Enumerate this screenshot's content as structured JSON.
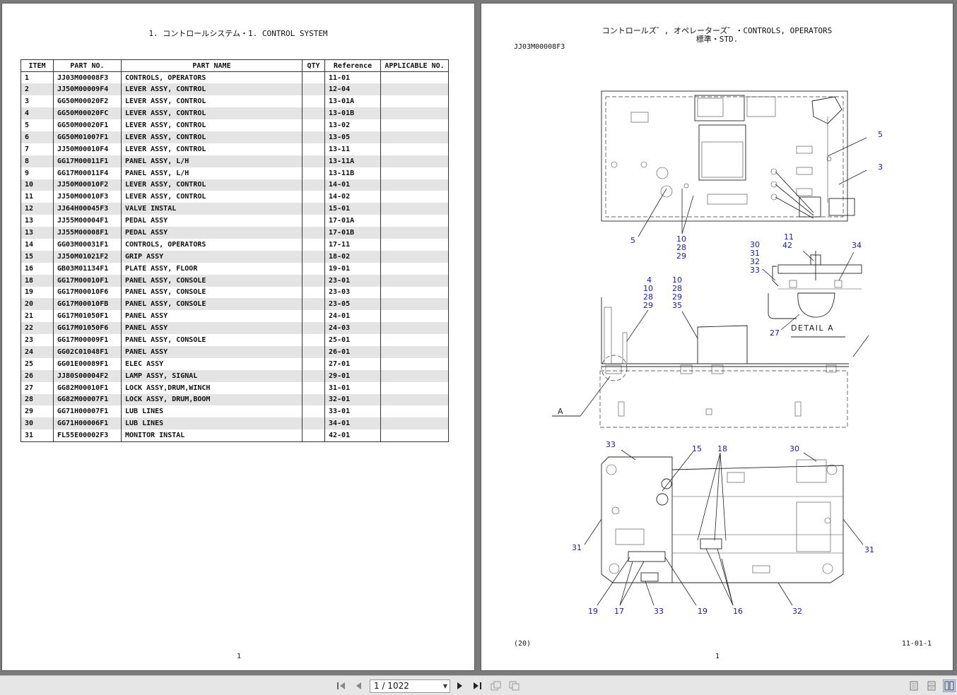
{
  "left_page": {
    "title": "1. コントロールシステム・1. CONTROL SYSTEM",
    "columns": [
      "ITEM",
      "PART NO.",
      "PART NAME",
      "QTY",
      "Reference",
      "APPLICABLE NO."
    ],
    "rows": [
      [
        "1",
        "JJ03M00008F3",
        "CONTROLS, OPERATORS",
        "",
        "11-01",
        ""
      ],
      [
        "2",
        "JJ50M00009F4",
        "LEVER ASSY, CONTROL",
        "",
        "12-04",
        ""
      ],
      [
        "3",
        "GG50M00020F2",
        "LEVER ASSY, CONTROL",
        "",
        "13-01A",
        ""
      ],
      [
        "4",
        "GG50M00020FC",
        "LEVER ASSY, CONTROL",
        "",
        "13-01B",
        ""
      ],
      [
        "5",
        "GG50M00020F1",
        "LEVER ASSY, CONTROL",
        "",
        "13-02",
        ""
      ],
      [
        "6",
        "GG50M01007F1",
        "LEVER ASSY, CONTROL",
        "",
        "13-05",
        ""
      ],
      [
        "7",
        "JJ50M00010F4",
        "LEVER ASSY, CONTROL",
        "",
        "13-11",
        ""
      ],
      [
        "8",
        "GG17M00011F1",
        "PANEL ASSY, L/H",
        "",
        "13-11A",
        ""
      ],
      [
        "9",
        "GG17M00011F4",
        "PANEL ASSY, L/H",
        "",
        "13-11B",
        ""
      ],
      [
        "10",
        "JJ50M00010F2",
        "LEVER ASSY, CONTROL",
        "",
        "14-01",
        ""
      ],
      [
        "11",
        "JJ50M00010F3",
        "LEVER ASSY, CONTROL",
        "",
        "14-02",
        ""
      ],
      [
        "12",
        "JJ64H00045F3",
        "VALVE INSTAL",
        "",
        "15-01",
        ""
      ],
      [
        "13",
        "JJ55M00004F1",
        "PEDAL ASSY",
        "",
        "17-01A",
        ""
      ],
      [
        "13",
        "JJ55M00008F1",
        "PEDAL ASSY",
        "",
        "17-01B",
        ""
      ],
      [
        "14",
        "GG03M00031F1",
        "CONTROLS, OPERATORS",
        "",
        "17-11",
        ""
      ],
      [
        "15",
        "JJ50M01021F2",
        "GRIP ASSY",
        "",
        "18-02",
        ""
      ],
      [
        "16",
        "GB03M01134F1",
        "PLATE ASSY, FLOOR",
        "",
        "19-01",
        ""
      ],
      [
        "18",
        "GG17M00010F1",
        "PANEL ASSY, CONSOLE",
        "",
        "23-01",
        ""
      ],
      [
        "19",
        "GG17M00010F6",
        "PANEL ASSY, CONSOLE",
        "",
        "23-03",
        ""
      ],
      [
        "20",
        "GG17M00010FB",
        "PANEL ASSY, CONSOLE",
        "",
        "23-05",
        ""
      ],
      [
        "21",
        "GG17M01050F1",
        "PANEL ASSY",
        "",
        "24-01",
        ""
      ],
      [
        "22",
        "GG17M01050F6",
        "PANEL ASSY",
        "",
        "24-03",
        ""
      ],
      [
        "23",
        "GG17M00009F1",
        "PANEL ASSY, CONSOLE",
        "",
        "25-01",
        ""
      ],
      [
        "24",
        "GG02C01048F1",
        "PANEL ASSY",
        "",
        "26-01",
        ""
      ],
      [
        "25",
        "GG01E00089F1",
        "ELEC ASSY",
        "",
        "27-01",
        ""
      ],
      [
        "26",
        "JJ80S00004F2",
        "LAMP ASSY, SIGNAL",
        "",
        "29-01",
        ""
      ],
      [
        "27",
        "GG82M00010F1",
        "LOCK ASSY,DRUM,WINCH",
        "",
        "31-01",
        ""
      ],
      [
        "28",
        "GG82M00007F1",
        "LOCK ASSY, DRUM,BOOM",
        "",
        "32-01",
        ""
      ],
      [
        "29",
        "GG71H00007F1",
        "LUB LINES",
        "",
        "33-01",
        ""
      ],
      [
        "30",
        "GG71H00006F1",
        "LUB LINES",
        "",
        "34-01",
        ""
      ],
      [
        "31",
        "FL55E00002F3",
        "MONITOR INSTAL",
        "",
        "42-01",
        ""
      ]
    ],
    "page_number": "1"
  },
  "right_page": {
    "title_line1": "コントロールズ゛, オペレーターズ゛・CONTROLS, OPERATORS",
    "title_line2": "標準・STD.",
    "part_code": "JJ03M00008F3",
    "detail_label": "DETAIL A",
    "view_label": "A",
    "callouts": {
      "top_view": [
        "5",
        "3",
        "5",
        "10",
        "28",
        "29"
      ],
      "side_view": [
        "4",
        "10",
        "28",
        "29",
        "10",
        "28",
        "29",
        "35"
      ],
      "detail": [
        "11",
        "42",
        "34",
        "30",
        "31",
        "32",
        "33",
        "27"
      ],
      "bottom_view": [
        "33",
        "15",
        "18",
        "30",
        "31",
        "31",
        "19",
        "17",
        "33",
        "19",
        "16",
        "32"
      ]
    },
    "footer_left": "(20)",
    "footer_right": "11-01-1",
    "page_number": "1"
  },
  "toolbar": {
    "page_indicator": "1 / 1022",
    "first_icon": "first-page-icon",
    "prev_icon": "previous-page-icon",
    "next_icon": "next-page-icon",
    "last_icon": "last-page-icon"
  }
}
